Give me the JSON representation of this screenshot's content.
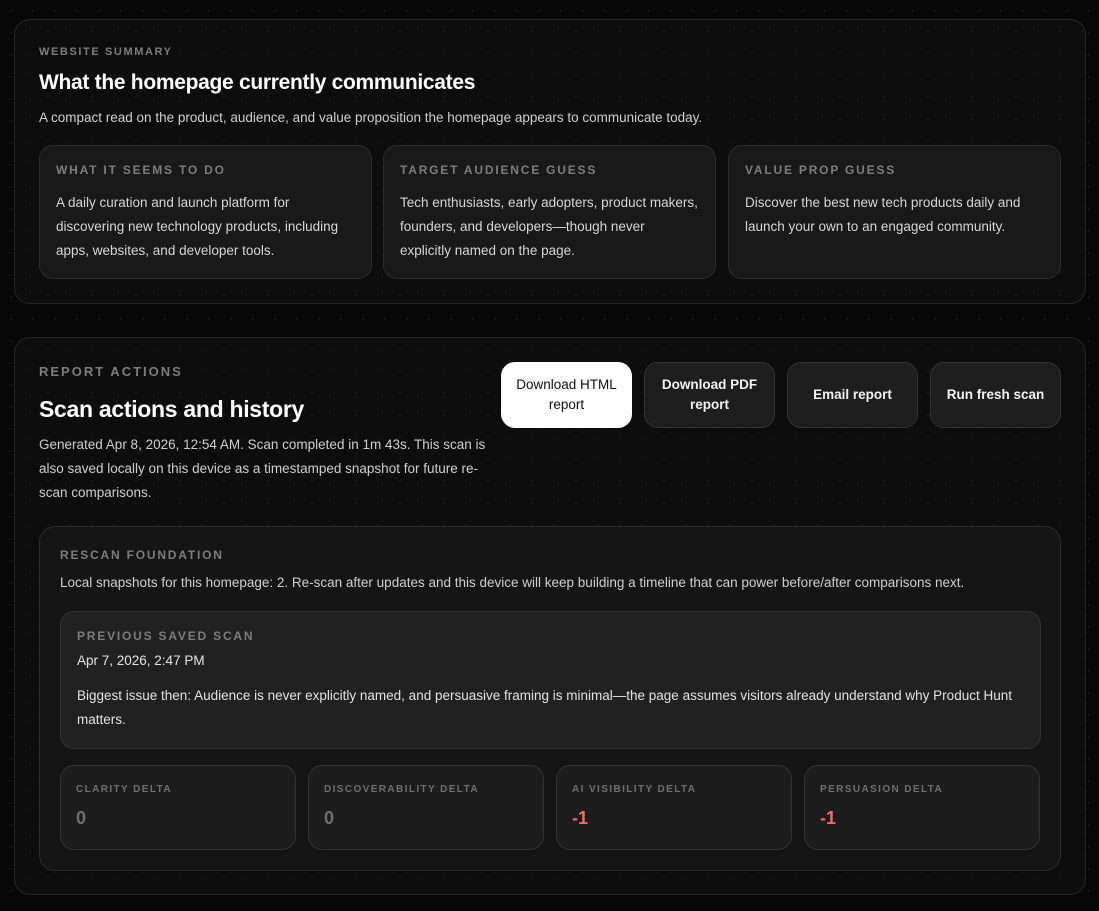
{
  "summary": {
    "eyebrow": "WEBSITE SUMMARY",
    "title": "What the homepage currently communicates",
    "description": "A compact read on the product, audience, and value proposition the homepage appears to communicate today.",
    "cards": [
      {
        "label": "WHAT IT SEEMS TO DO",
        "text": "A daily curation and launch platform for discovering new technology products, including apps, websites, and developer tools."
      },
      {
        "label": "TARGET AUDIENCE GUESS",
        "text": "Tech enthusiasts, early adopters, product makers, founders, and developers—though never explicitly named on the page."
      },
      {
        "label": "VALUE PROP GUESS",
        "text": "Discover the best new tech products daily and launch your own to an engaged community."
      }
    ]
  },
  "actions": {
    "eyebrow": "REPORT ACTIONS",
    "title": "Scan actions and history",
    "description": "Generated Apr 8, 2026, 12:54 AM. Scan completed in 1m 43s. This scan is also saved locally on this device as a timestamped snapshot for future re-scan comparisons.",
    "buttons": {
      "download_html": "Download HTML report",
      "download_pdf": "Download PDF report",
      "email": "Email report",
      "rescan": "Run fresh scan"
    }
  },
  "rescan": {
    "eyebrow": "RESCAN FOUNDATION",
    "description": "Local snapshots for this homepage: 2. Re-scan after updates and this device will keep building a timeline that can power before/after comparisons next.",
    "previous": {
      "eyebrow": "PREVIOUS SAVED SCAN",
      "date": "Apr 7, 2026, 2:47 PM",
      "issue": "Biggest issue then: Audience is never explicitly named, and persuasive framing is minimal—the page assumes visitors already understand why Product Hunt matters."
    },
    "deltas": [
      {
        "label": "CLARITY DELTA",
        "value": "0"
      },
      {
        "label": "DISCOVERABILITY DELTA",
        "value": "0"
      },
      {
        "label": "AI VISIBILITY DELTA",
        "value": "-1"
      },
      {
        "label": "PERSUASION DELTA",
        "value": "-1"
      }
    ]
  },
  "colors": {
    "background": "#070707",
    "panel": "#0e0e0e",
    "primary_button": "#ffffff",
    "negative_delta": "#f06a6a",
    "neutral_delta": "#6f6f6f"
  }
}
